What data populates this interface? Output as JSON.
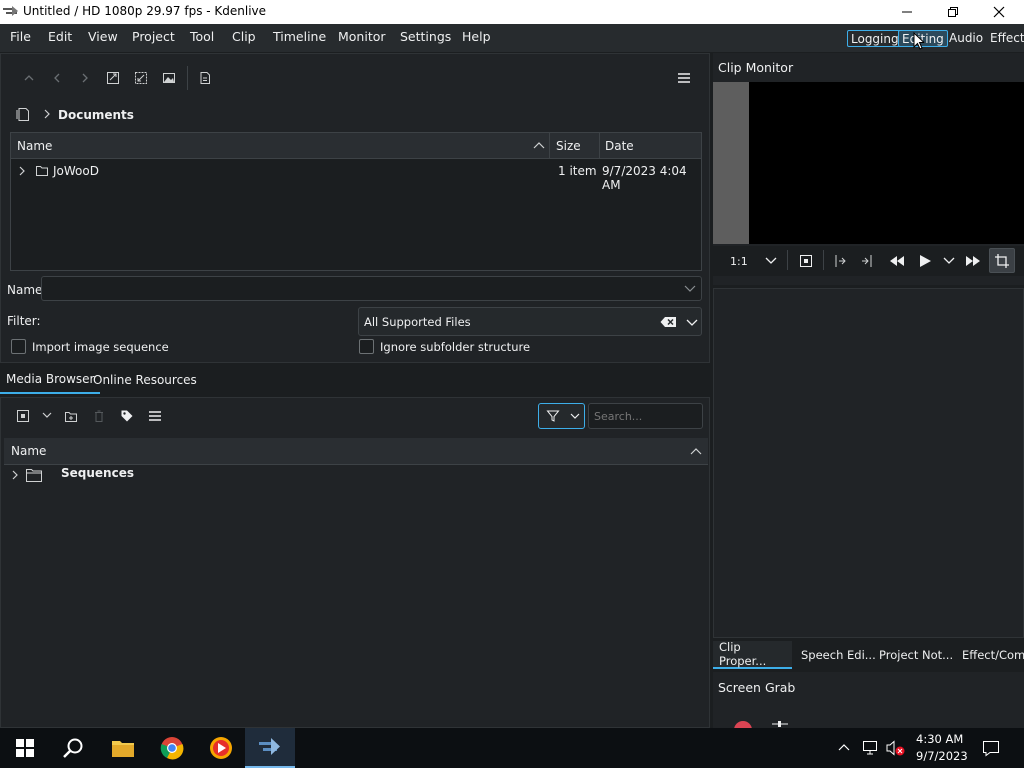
{
  "window": {
    "title": "Untitled / HD 1080p 29.97 fps - Kdenlive"
  },
  "menu": [
    "File",
    "Edit",
    "View",
    "Project",
    "Tool",
    "Clip",
    "Timeline",
    "Monitor",
    "Settings",
    "Help"
  ],
  "workspaces": {
    "logging": "Logging",
    "editing": "Editing",
    "audio": "Audio",
    "effects": "Effects"
  },
  "file_browser": {
    "breadcrumb": "Documents",
    "columns": {
      "name": "Name",
      "size": "Size",
      "date": "Date"
    },
    "rows": [
      {
        "name": "JoWooD",
        "size": "1 item",
        "date": "9/7/2023 4:04 AM"
      }
    ],
    "name_label": "Name:",
    "name_value": "",
    "filter_label": "Filter:",
    "filter_value": "All Supported Files",
    "import_seq_label": "Import image sequence",
    "ignore_subfolder_label": "Ignore subfolder structure"
  },
  "lower_tabs": {
    "media_browser": "Media Browser",
    "online_resources": "Online Resources"
  },
  "bin": {
    "search_placeholder": "Search...",
    "column_name": "Name",
    "items": [
      {
        "name": "Sequences"
      }
    ]
  },
  "clip_monitor": {
    "title": "Clip Monitor",
    "zoom": "1:1"
  },
  "right_tabs": {
    "clip_properties": "Clip Proper...",
    "speech_editor": "Speech Edi...",
    "project_notes": "Project Not...",
    "effect_composition": "Effect/Compo"
  },
  "screen_grab": {
    "title": "Screen Grab"
  },
  "taskbar": {
    "time": "4:30 AM",
    "date": "9/7/2023"
  },
  "colors": {
    "accent": "#3daee9",
    "bg": "#1b1e20",
    "panel": "#202326"
  }
}
